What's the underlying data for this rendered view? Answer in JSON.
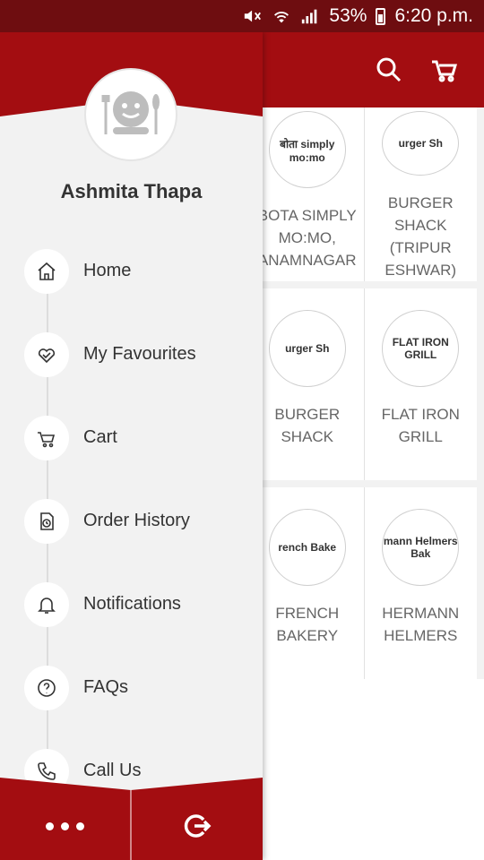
{
  "status_bar": {
    "battery": "53%",
    "time": "6:20 p.m."
  },
  "header": {
    "search_icon": "search-icon",
    "cart_icon": "cart-icon"
  },
  "restaurants": [
    {
      "name": "BOTA SIMPLY MO:MO, ANAMNAGAR",
      "logo_text": "बोता simply mo:mo"
    },
    {
      "name": "BURGER SHACK (TRIPUR ESHWAR)",
      "logo_text": "urger Sh"
    },
    {
      "name": "BURGER SHACK",
      "logo_text": "urger Sh"
    },
    {
      "name": "FLAT IRON GRILL",
      "logo_text": "FLAT IRON GRILL"
    },
    {
      "name": "FRENCH BAKERY",
      "logo_text": "rench Bake"
    },
    {
      "name": "HERMANN HELMERS",
      "logo_text": "mann Helmers Bak"
    }
  ],
  "drawer": {
    "user_name": "Ashmita Thapa",
    "menu": [
      {
        "label": "Home",
        "icon": "home-icon"
      },
      {
        "label": "My Favourites",
        "icon": "heart-icon"
      },
      {
        "label": "Cart",
        "icon": "cart-icon"
      },
      {
        "label": "Order History",
        "icon": "order-history-icon"
      },
      {
        "label": "Notifications",
        "icon": "bell-icon"
      },
      {
        "label": "FAQs",
        "icon": "question-icon"
      },
      {
        "label": "Call Us",
        "icon": "phone-icon"
      }
    ],
    "footer": {
      "more_icon": "more-icon",
      "logout_icon": "logout-icon"
    }
  },
  "colors": {
    "primary": "#a30d11",
    "status_bar": "#6e0d10",
    "drawer_bg": "#f2f2f2"
  }
}
